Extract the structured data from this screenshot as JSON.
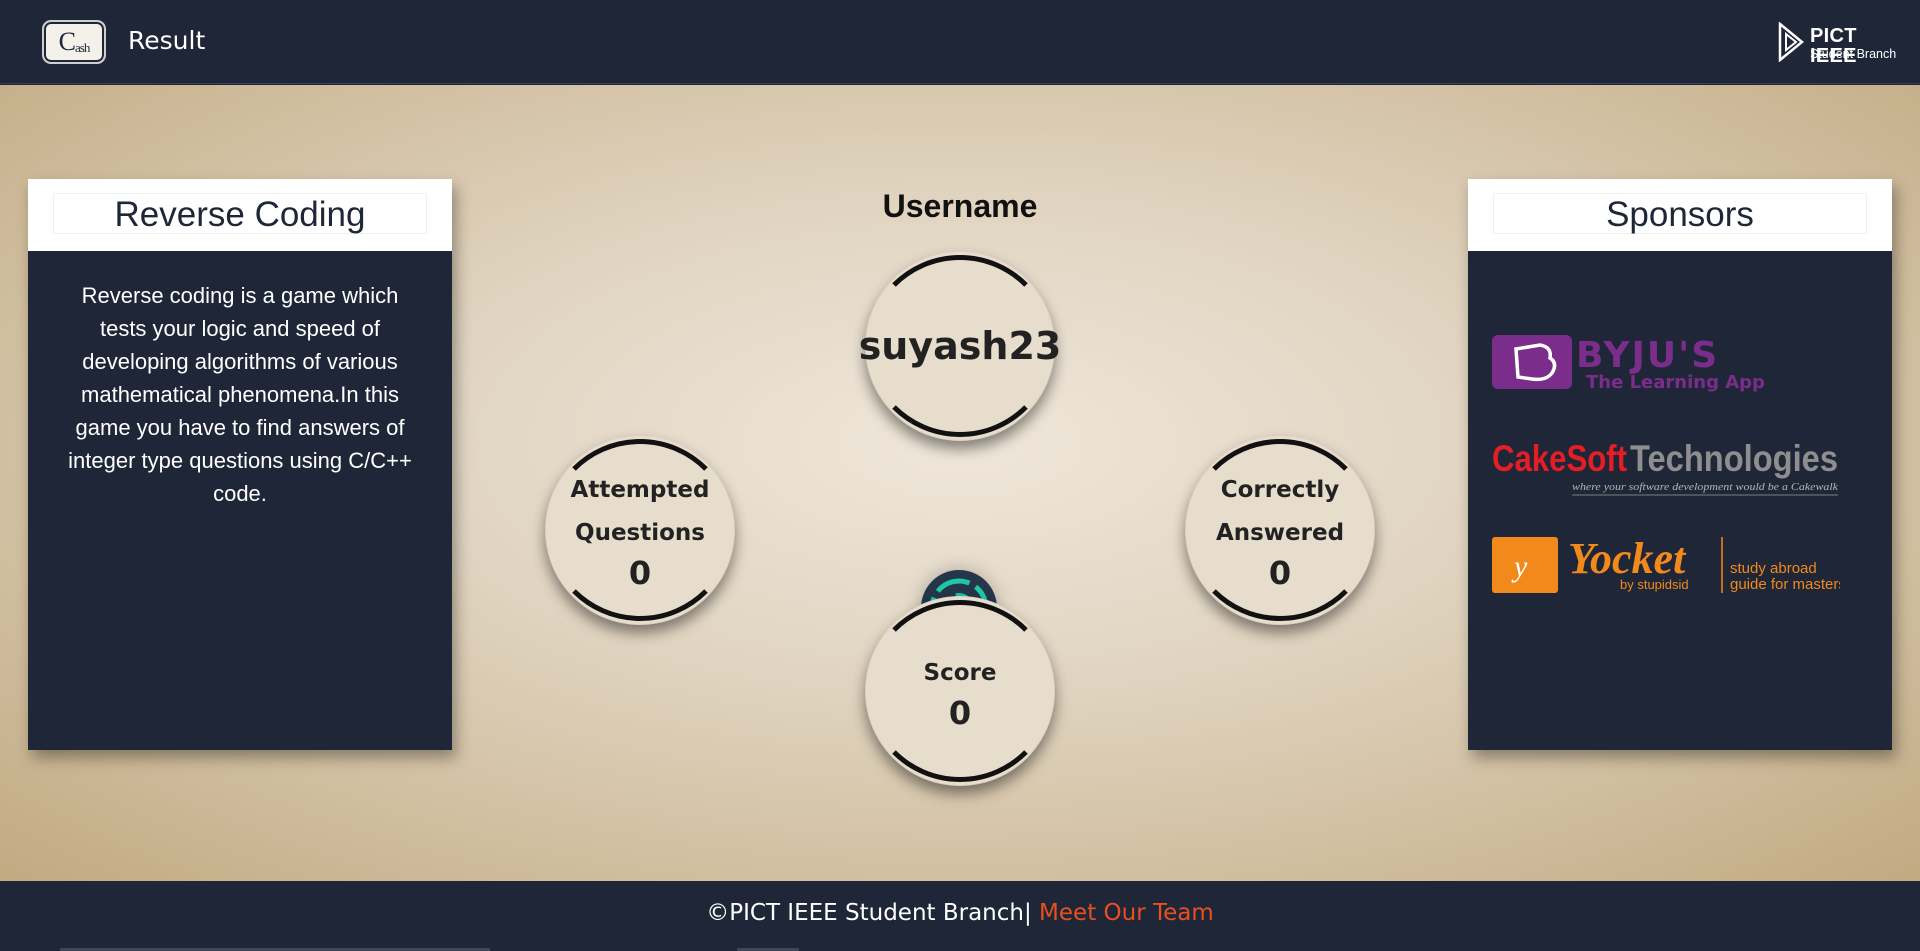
{
  "header": {
    "logo": {
      "main": "C",
      "sub": "ash"
    },
    "title": "Result",
    "org_logo": {
      "name": "PICT IEEE",
      "sub": "Student Branch"
    }
  },
  "left_card": {
    "title": "Reverse Coding",
    "description": "Reverse coding is a game which tests your logic and speed of developing algorithms of various mathematical phenomena.In this game you have to find answers of integer type questions using C/C++ code."
  },
  "right_card": {
    "title": "Sponsors",
    "sponsors": [
      {
        "name": "BYJU'S",
        "tagline": "The Learning App",
        "brand_color": "#7b2d8b"
      },
      {
        "name": "CakeSoft",
        "name2": "Technologies",
        "tagline": "where your software development would be a Cakewalk",
        "brand_color": "#e31e24"
      },
      {
        "name": "Yocket",
        "by": "by stupidsid",
        "tagline1": "study abroad",
        "tagline2": "guide for masters",
        "brand_color": "#f2891b"
      }
    ]
  },
  "stats": {
    "username_label": "Username",
    "username": "suyash23",
    "attempted_label_1": "Attempted",
    "attempted_label_2": "Questions",
    "attempted_value": "0",
    "correct_label_1": "Correctly",
    "correct_label_2": "Answered",
    "correct_value": "0",
    "score_label": "Score",
    "score_value": "0"
  },
  "footer": {
    "copyright": "©PICT IEEE Student Branch|",
    "link": "Meet Our Team"
  },
  "colors": {
    "navy": "#1e2638",
    "accent": "#e8501f",
    "spinner": "#1ec8a5"
  }
}
